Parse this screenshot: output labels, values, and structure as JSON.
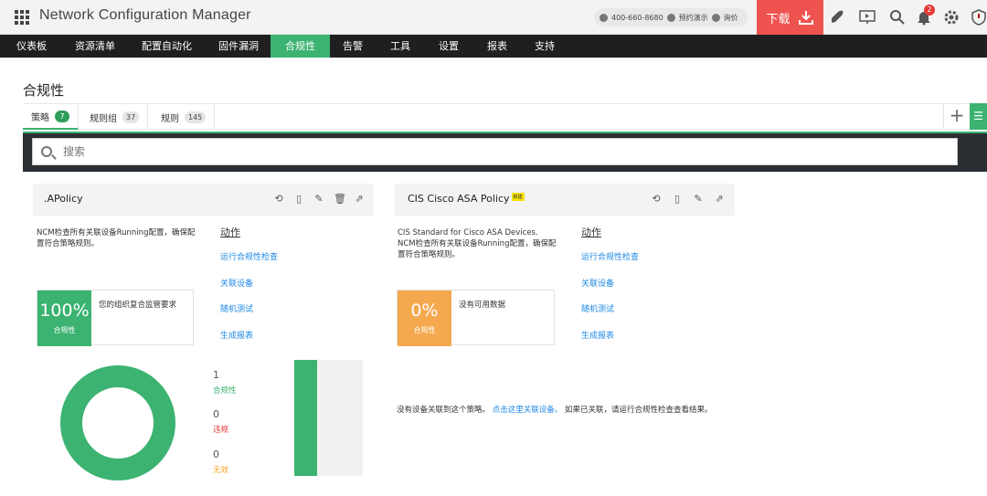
{
  "header": {
    "app_title": "Network Configuration Manager",
    "phone": "400-660-8680",
    "demo": "预约演示",
    "quote": "询价",
    "download": "下载",
    "notification_count": "2"
  },
  "nav": [
    {
      "label": "仪表板",
      "active": false
    },
    {
      "label": "资源清单",
      "active": false
    },
    {
      "label": "配置自动化",
      "active": false
    },
    {
      "label": "固件漏洞",
      "active": false
    },
    {
      "label": "合规性",
      "active": true
    },
    {
      "label": "告警",
      "active": false
    },
    {
      "label": "工具",
      "active": false
    },
    {
      "label": "设置",
      "active": false
    },
    {
      "label": "报表",
      "active": false
    },
    {
      "label": "支持",
      "active": false
    }
  ],
  "page": {
    "title": "合规性",
    "tabs": [
      {
        "label": "策略",
        "count": "7",
        "active": true
      },
      {
        "label": "规则组",
        "count": "37",
        "active": false
      },
      {
        "label": "规则",
        "count": "145",
        "active": false
      }
    ],
    "search_placeholder": "搜索"
  },
  "policies": [
    {
      "name": ".APolicy",
      "new_tag": "",
      "description": "NCM检查所有关联设备Running配置，确保配置符合策略规则。",
      "actions_title": "动作",
      "actions": [
        "运行合规性检查",
        "关联设备",
        "随机测试",
        "生成报表"
      ],
      "score": "100%",
      "score_label": "合规性",
      "score_text": "您的组织复合监管要求",
      "score_color": "#3cb371",
      "stats": [
        {
          "value": 1,
          "label": "合规性",
          "color": "#3cb371"
        },
        {
          "value": 0,
          "label": "违规",
          "color": "#e53935"
        },
        {
          "value": 0,
          "label": "无效",
          "color": "#f5a623"
        }
      ]
    },
    {
      "name": "CIS Cisco ASA Policy",
      "new_tag": "新建",
      "description": "CIS Standard for Cisco ASA Devices. NCM检查所有关联设备Running配置，确保配置符合策略规则。",
      "actions_title": "动作",
      "actions": [
        "运行合规性检查",
        "关联设备",
        "随机测试",
        "生成报表"
      ],
      "score": "0%",
      "score_label": "合规性",
      "score_text": "没有可用数据",
      "score_color": "#f5a94f",
      "note_prefix": "没有设备关联到这个策略。",
      "note_link": "点击这里关联设备。",
      "note_suffix": "如果已关联，请运行合规性检查查看结果。"
    }
  ]
}
